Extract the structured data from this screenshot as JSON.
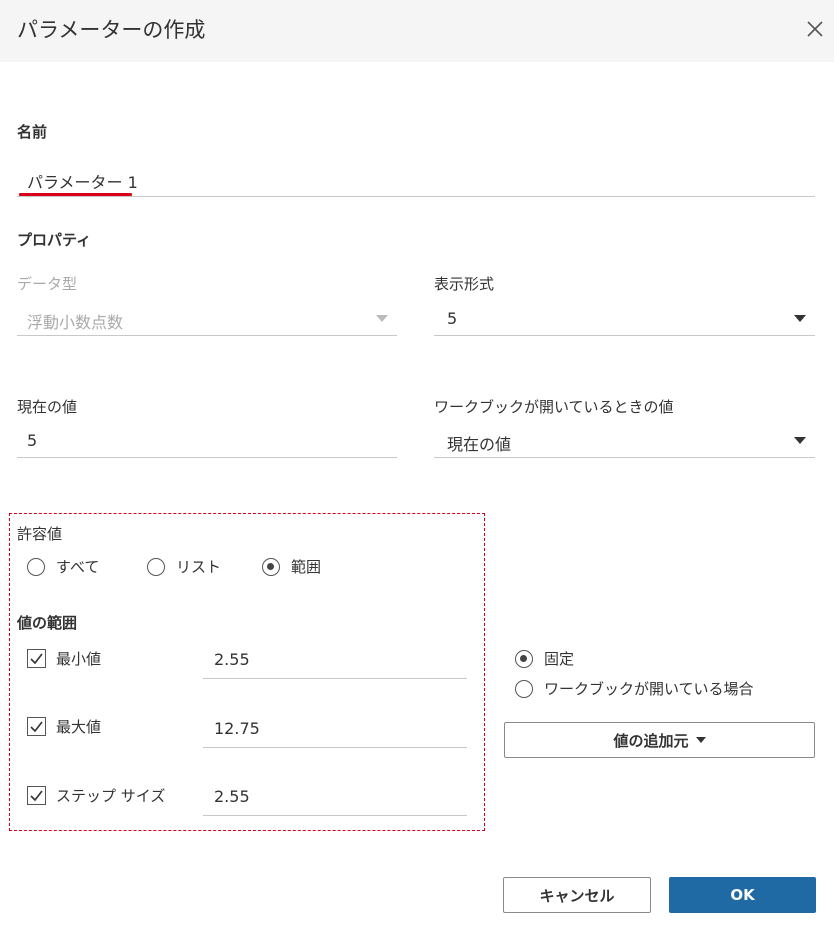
{
  "dialog": {
    "title": "パラメーターの作成",
    "close_icon": "close-icon"
  },
  "name_section": {
    "label": "名前",
    "value": "パラメーター 1"
  },
  "properties": {
    "label": "プロパティ",
    "data_type": {
      "label": "データ型",
      "value": "浮動小数点数"
    },
    "display_format": {
      "label": "表示形式",
      "value": "5"
    },
    "current_value": {
      "label": "現在の値",
      "value": "5"
    },
    "workbook_open_value": {
      "label": "ワークブックが開いているときの値",
      "value": "現在の値"
    }
  },
  "allowable_values": {
    "label": "許容値",
    "options": [
      {
        "label": "すべて",
        "selected": false
      },
      {
        "label": "リスト",
        "selected": false
      },
      {
        "label": "範囲",
        "selected": true
      }
    ]
  },
  "range": {
    "label": "値の範囲",
    "minimum": {
      "label": "最小値",
      "checked": true,
      "value": "2.55"
    },
    "maximum": {
      "label": "最大値",
      "checked": true,
      "value": "12.75"
    },
    "step_size": {
      "label": "ステップ サイズ",
      "checked": true,
      "value": "2.55"
    },
    "source_options": [
      {
        "label": "固定",
        "selected": true
      },
      {
        "label": "ワークブックが開いている場合",
        "selected": false
      }
    ],
    "add_from_button": "値の追加元"
  },
  "footer": {
    "cancel": "キャンセル",
    "ok": "OK"
  },
  "colors": {
    "primary": "#1f6aa5",
    "highlight_red": "#d9001b",
    "titlebar_bg": "#f5f5f5"
  }
}
